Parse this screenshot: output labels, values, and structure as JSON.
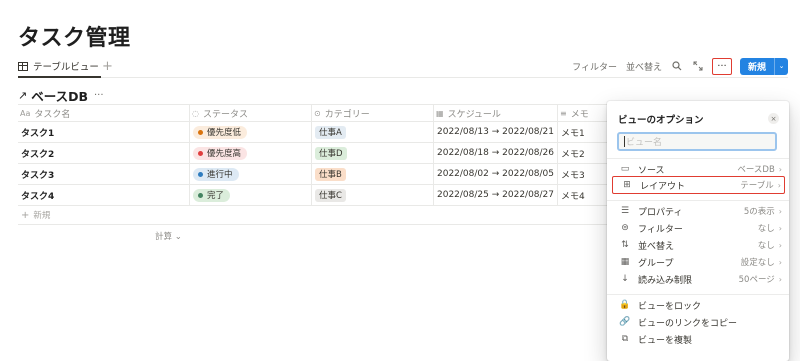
{
  "page": {
    "title": "タスク管理"
  },
  "views": {
    "active_tab": "テーブルビュー",
    "add_label": "+"
  },
  "toolbar": {
    "filter": "フィルター",
    "sort": "並べ替え",
    "more": "···",
    "new_label": "新規",
    "new_dropdown": "⌄"
  },
  "database": {
    "arrow": "↗",
    "title": "ベースDB",
    "more": "···"
  },
  "table": {
    "columns": [
      {
        "icon": "Aa",
        "label": "タスク名"
      },
      {
        "icon": "◌",
        "label": "ステータス"
      },
      {
        "icon": "⊙",
        "label": "カテゴリー"
      },
      {
        "icon": "▦",
        "label": "スケジュール"
      },
      {
        "icon": "≡",
        "label": "メモ"
      }
    ],
    "rows": [
      {
        "name": "タスク1",
        "status": "優先度低",
        "status_bg": "#fbecdd",
        "status_dot": "#d9730d",
        "category": "仕事A",
        "category_bg": "#e3ebf2",
        "schedule": "2022/08/13 → 2022/08/21",
        "memo": "メモ1"
      },
      {
        "name": "タスク2",
        "status": "優先度高",
        "status_bg": "#fbe4e4",
        "status_dot": "#e03e3e",
        "category": "仕事D",
        "category_bg": "#dbeddb",
        "schedule": "2022/08/18 → 2022/08/26",
        "memo": "メモ2"
      },
      {
        "name": "タスク3",
        "status": "進行中",
        "status_bg": "#dde9f4",
        "status_dot": "#2e7cbf",
        "category": "仕事B",
        "category_bg": "#fadec9",
        "schedule": "2022/08/02 → 2022/08/05",
        "memo": "メモ3"
      },
      {
        "name": "タスク4",
        "status": "完了",
        "status_bg": "#dbeddb",
        "status_dot": "#448361",
        "category": "仕事C",
        "category_bg": "#e9e8e6",
        "schedule": "2022/08/25 → 2022/08/27",
        "memo": "メモ4"
      }
    ],
    "new_row": "新規",
    "calc": "計算 ⌄"
  },
  "options_panel": {
    "title": "ビューのオプション",
    "close": "×",
    "name_placeholder": "ビュー名",
    "items": [
      {
        "icon": "▭",
        "label": "ソース",
        "value": "ベースDB",
        "chevron": "›"
      },
      {
        "icon": "⊞",
        "label": "レイアウト",
        "value": "テーブル",
        "chevron": "›"
      },
      {
        "icon": "☰",
        "label": "プロパティ",
        "value": "5の表示",
        "chevron": "›"
      },
      {
        "icon": "⊜",
        "label": "フィルター",
        "value": "なし",
        "chevron": "›"
      },
      {
        "icon": "⇅",
        "label": "並べ替え",
        "value": "なし",
        "chevron": "›"
      },
      {
        "icon": "▦",
        "label": "グループ",
        "value": "設定なし",
        "chevron": "›"
      },
      {
        "icon": "↓",
        "label": "読み込み制限",
        "value": "50ページ",
        "chevron": "›"
      },
      {
        "icon": "🔒",
        "label": "ビューをロック",
        "value": "",
        "chevron": ""
      },
      {
        "icon": "🔗",
        "label": "ビューのリンクをコピー",
        "value": "",
        "chevron": ""
      },
      {
        "icon": "⧉",
        "label": "ビューを複製",
        "value": "",
        "chevron": ""
      }
    ]
  }
}
